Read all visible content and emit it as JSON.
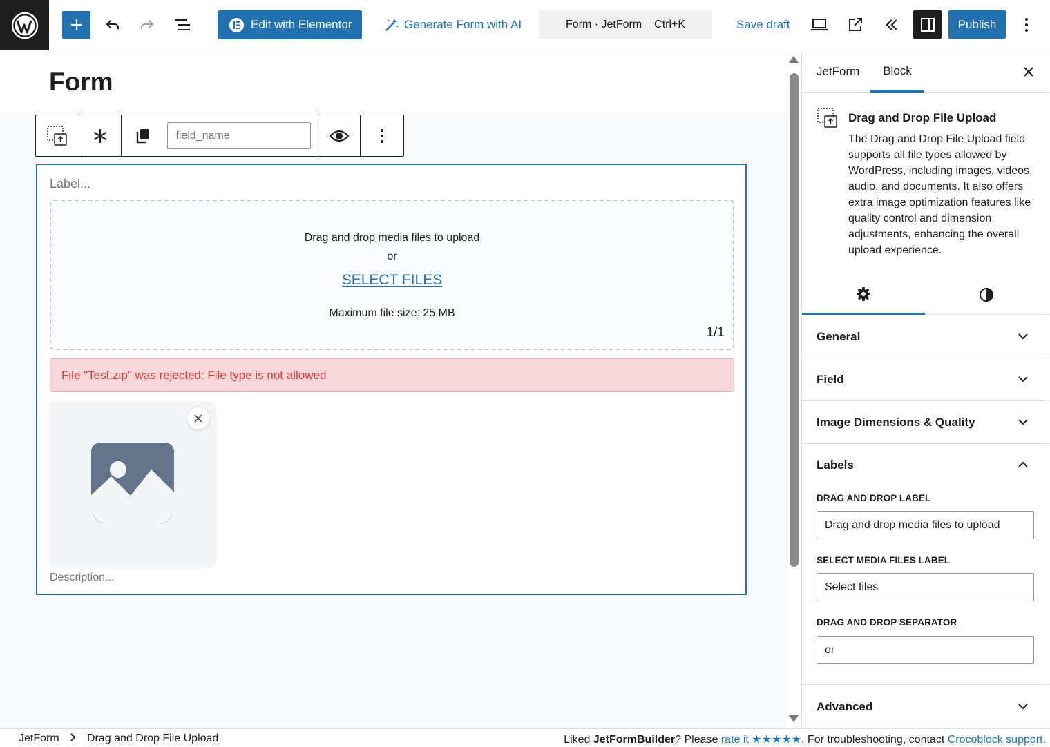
{
  "toolbar": {
    "edit_with_elementor": "Edit with Elementor",
    "generate_form_ai": "Generate Form with AI",
    "command_title": "Form · JetForm",
    "command_shortcut": "Ctrl+K",
    "save_draft": "Save draft",
    "publish": "Publish"
  },
  "canvas": {
    "page_title": "Form",
    "block_toolbar": {
      "field_name_placeholder": "field_name"
    },
    "field": {
      "label_placeholder": "Label...",
      "drag_drop_label": "Drag and drop media files to upload",
      "separator": "or",
      "select_files": "SELECT FILES",
      "max_file_size": "Maximum file size: 25 MB",
      "file_count": "1/1",
      "error_message": "File \"Test.zip\" was rejected: File type is not allowed",
      "description_placeholder": "Description..."
    }
  },
  "sidebar": {
    "tabs": [
      "JetForm",
      "Block"
    ],
    "active_tab": "Block",
    "block_title": "Drag and Drop File Upload",
    "block_description": "The Drag and Drop File Upload field supports all file types allowed by WordPress, including images, videos, audio, and documents. It also offers extra image optimization features like quality control and dimension adjustments, enhancing the overall upload experience.",
    "panels": {
      "general": "General",
      "field": "Field",
      "image": "Image Dimensions & Quality",
      "labels": "Labels",
      "advanced": "Advanced"
    },
    "labels_panel": {
      "drag_drop_label_title": "DRAG AND DROP LABEL",
      "drag_drop_label_value": "Drag and drop media files to upload",
      "select_media_label_title": "SELECT MEDIA FILES LABEL",
      "select_media_label_value": "Select files",
      "separator_title": "DRAG AND DROP SEPARATOR",
      "separator_value": "or"
    }
  },
  "footer": {
    "breadcrumb": [
      "JetForm",
      "Drag and Drop File Upload"
    ],
    "note_prefix": "Liked ",
    "note_brand": "JetFormBuilder",
    "note_mid": "? Please ",
    "note_rate": "rate it ★★★★★",
    "note_mid2": ". For troubleshooting, contact ",
    "note_support": "Crocoblock support",
    "note_end": "."
  },
  "colors": {
    "accent": "#2271b1",
    "error_bg": "#f8d7da",
    "error_text": "#d63638",
    "dark": "#1e1e1e"
  }
}
